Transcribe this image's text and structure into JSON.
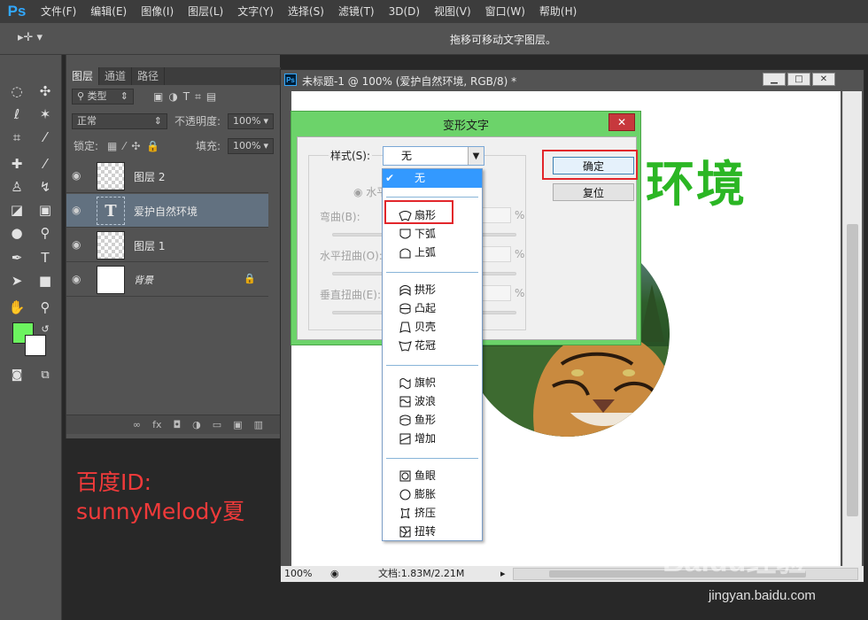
{
  "app": {
    "logo": "Ps",
    "menu": [
      "文件(F)",
      "编辑(E)",
      "图像(I)",
      "图层(L)",
      "文字(Y)",
      "选择(S)",
      "滤镜(T)",
      "3D(D)",
      "视图(V)",
      "窗口(W)",
      "帮助(H)"
    ]
  },
  "options_bar": {
    "tool_icon": "move-tool-icon",
    "hint": "拖移可移动文字图层。"
  },
  "layers_panel": {
    "tabs": [
      "图层",
      "通道",
      "路径"
    ],
    "filter_label": "类型",
    "blend_mode": "正常",
    "opacity_label": "不透明度:",
    "opacity_value": "100%",
    "lock_label": "锁定:",
    "fill_label": "填充:",
    "fill_value": "100%",
    "layers": [
      {
        "name": "图层 2",
        "type": "image",
        "selected": false
      },
      {
        "name": "爱护自然环境",
        "type": "text",
        "selected": true
      },
      {
        "name": "图层 1",
        "type": "image",
        "selected": false
      },
      {
        "name": "背景",
        "type": "background",
        "selected": false
      }
    ],
    "footer_icons": [
      "link-icon",
      "fx-icon",
      "mask-icon",
      "adjustment-icon",
      "folder-icon",
      "new-layer-icon",
      "trash-icon"
    ]
  },
  "document": {
    "title": "未标题-1 @ 100% (爱护自然环境, RGB/8) *",
    "zoom": "100%",
    "info": "文档:1.83M/2.21M",
    "canvas_text": "环境"
  },
  "warp_dialog": {
    "title": "变形文字",
    "style_label": "样式(S):",
    "style_value": "无",
    "horizontal_label": "水平",
    "bend_label": "弯曲(B):",
    "hdistort_label": "水平扭曲(O):",
    "vdistort_label": "垂直扭曲(E):",
    "percent": "%",
    "ok_label": "确定",
    "reset_label": "复位",
    "close_label": "✕"
  },
  "style_options": [
    {
      "label": "无",
      "selected": true
    },
    {
      "label": "扇形",
      "highlighted": true
    },
    {
      "label": "下弧"
    },
    {
      "label": "上弧"
    },
    {
      "label": "拱形"
    },
    {
      "label": "凸起"
    },
    {
      "label": "贝壳"
    },
    {
      "label": "花冠"
    },
    {
      "label": "旗帜"
    },
    {
      "label": "波浪"
    },
    {
      "label": "鱼形"
    },
    {
      "label": "增加"
    },
    {
      "label": "鱼眼"
    },
    {
      "label": "膨胀"
    },
    {
      "label": "挤压"
    },
    {
      "label": "扭转"
    }
  ],
  "watermark": {
    "author_line1": "百度ID:",
    "author_line2": "sunnyMelody夏",
    "logo": "Baidu经验",
    "url": "jingyan.baidu.com"
  },
  "colors": {
    "foreground": "#6cf35f",
    "background": "#ffffff",
    "highlight": "#e2262b",
    "canvas_text": "#2bb624"
  }
}
